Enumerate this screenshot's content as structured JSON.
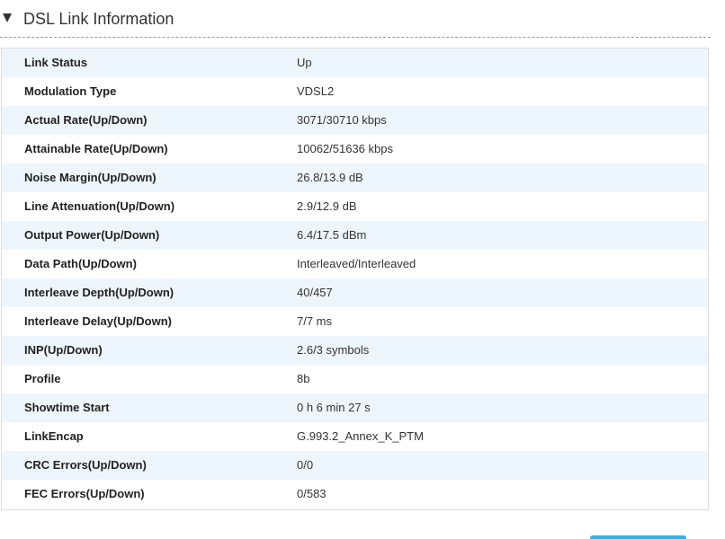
{
  "section": {
    "title": "DSL Link Information",
    "caret_icon": "caret-down-icon"
  },
  "rows": [
    {
      "label": "Link Status",
      "value": "Up"
    },
    {
      "label": "Modulation Type",
      "value": "VDSL2"
    },
    {
      "label": "Actual Rate(Up/Down)",
      "value": "3071/30710 kbps"
    },
    {
      "label": "Attainable Rate(Up/Down)",
      "value": "10062/51636 kbps"
    },
    {
      "label": "Noise Margin(Up/Down)",
      "value": "26.8/13.9 dB"
    },
    {
      "label": "Line Attenuation(Up/Down)",
      "value": "2.9/12.9 dB"
    },
    {
      "label": "Output Power(Up/Down)",
      "value": "6.4/17.5 dBm"
    },
    {
      "label": "Data Path(Up/Down)",
      "value": "Interleaved/Interleaved"
    },
    {
      "label": "Interleave Depth(Up/Down)",
      "value": "40/457"
    },
    {
      "label": "Interleave Delay(Up/Down)",
      "value": "7/7 ms"
    },
    {
      "label": "INP(Up/Down)",
      "value": "2.6/3 symbols"
    },
    {
      "label": "Profile",
      "value": "8b"
    },
    {
      "label": "Showtime Start",
      "value": "0 h 6 min 27 s"
    },
    {
      "label": "LinkEncap",
      "value": "G.993.2_Annex_K_PTM"
    },
    {
      "label": "CRC Errors(Up/Down)",
      "value": "0/0"
    },
    {
      "label": "FEC Errors(Up/Down)",
      "value": "0/583"
    }
  ],
  "colors": {
    "row_alt_background": "#eef6fd",
    "button_accent": "#3aaee0"
  }
}
